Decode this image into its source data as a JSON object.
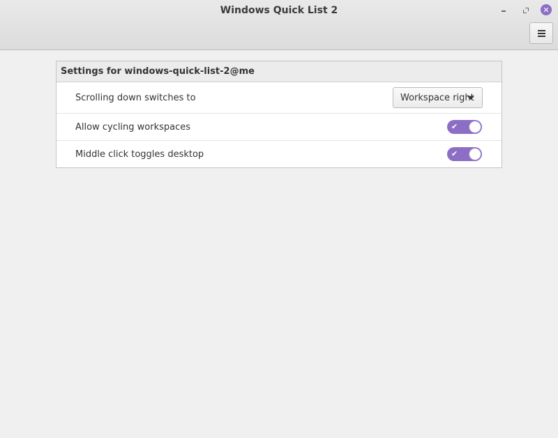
{
  "window": {
    "title": "Windows Quick List 2",
    "accent_color": "#8c6ec4",
    "controls": {
      "minimize_icon": "minimize-icon",
      "maximize_icon": "maximize-icon",
      "close_icon": "close-icon"
    },
    "menu_icon": "hamburger-menu-icon"
  },
  "settings": {
    "header": "Settings for windows-quick-list-2@me",
    "rows": [
      {
        "label": "Scrolling down switches to",
        "control": "dropdown",
        "value": "Workspace right"
      },
      {
        "label": "Allow cycling workspaces",
        "control": "switch",
        "on": true,
        "icon": "check-icon"
      },
      {
        "label": "Middle click toggles desktop",
        "control": "switch",
        "on": true,
        "icon": "check-icon"
      }
    ]
  }
}
